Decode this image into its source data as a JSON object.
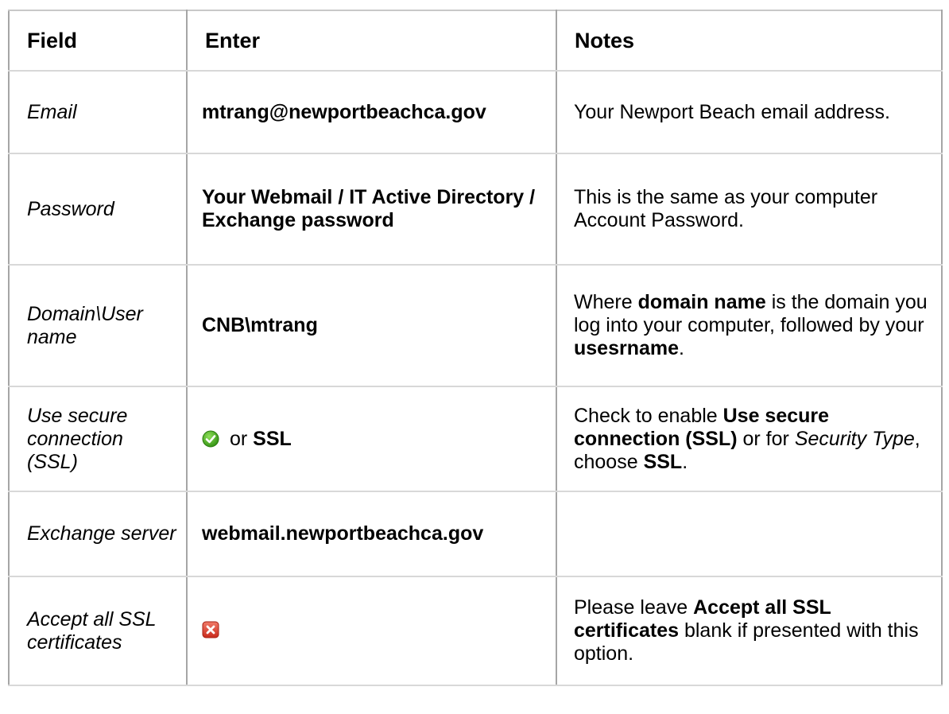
{
  "table": {
    "headers": {
      "field": "Field",
      "enter": "Enter",
      "notes": "Notes"
    },
    "rows": {
      "email": {
        "field": "Email",
        "enter": "mtrang@newportbeachca.gov",
        "notes": "Your Newport Beach email address."
      },
      "password": {
        "field": "Password",
        "enter": "Your Webmail / IT Active Directory / Exchange password",
        "notes": "This is the same as your computer Account Password."
      },
      "domain_user": {
        "field": "Domain\\User name",
        "enter": "CNB\\mtrang",
        "notes": {
          "part1": "Where ",
          "bold1": "domain name",
          "part2": " is the domain you log into your computer, followed by your ",
          "bold2": "usesrname",
          "part3": "."
        }
      },
      "secure_connection": {
        "field": "Use secure connection (SSL)",
        "enter": {
          "icon": "green-check-icon",
          "or": "or",
          "value": "SSL"
        },
        "notes": {
          "part1": "Check to enable ",
          "bold1": "Use secure connection (SSL)",
          "part2": " or for ",
          "italic1": "Security Type",
          "part3": ", choose ",
          "bold2": "SSL",
          "part4": "."
        }
      },
      "exchange_server": {
        "field": "Exchange server",
        "enter": "webmail.newportbeachca.gov",
        "notes": ""
      },
      "accept_ssl": {
        "field": "Accept all SSL certificates",
        "enter": {
          "icon": "red-x-icon"
        },
        "notes": {
          "part1": "Please leave ",
          "bold1": "Accept all SSL certificates",
          "part2": " blank if presented with this option."
        }
      }
    }
  },
  "colors": {
    "check_green": "#3aa313",
    "x_red": "#d93b2b",
    "grid_dark": "#a6a6a6",
    "grid_light": "#d8d8d8"
  }
}
